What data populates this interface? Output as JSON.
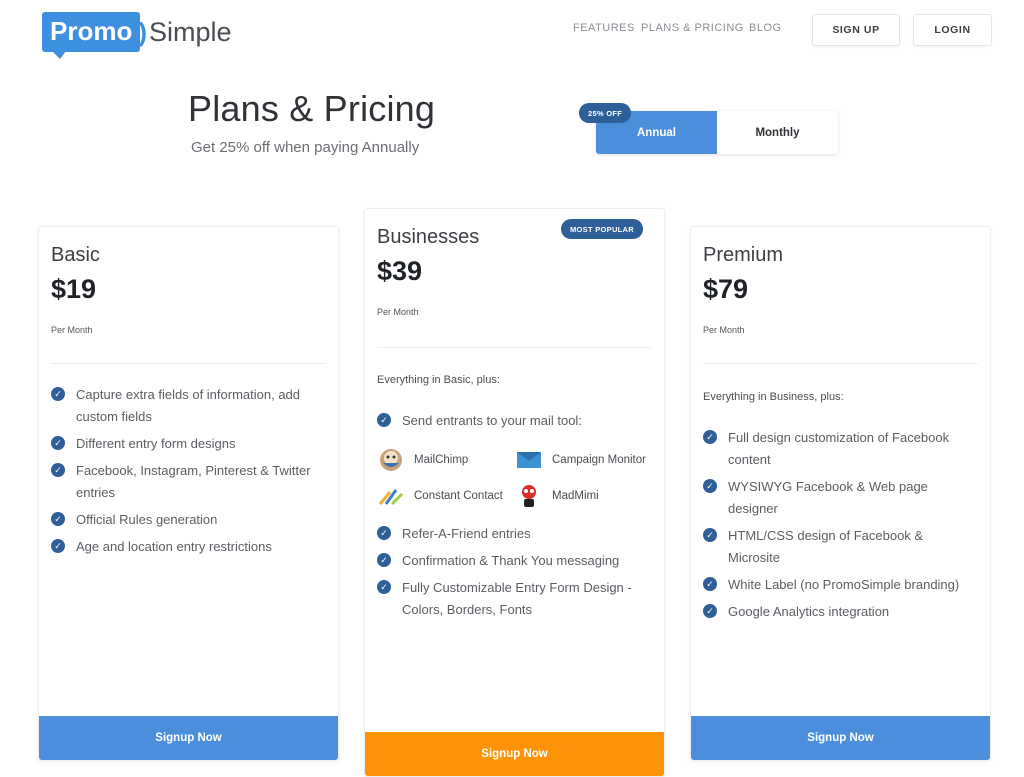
{
  "header": {
    "logo_promo": "Promo",
    "logo_simple": "Simple",
    "nav": [
      "FEATURES",
      "PLANS & PRICING",
      "BLOG"
    ],
    "signup_label": "SIGN UP",
    "login_label": "LOGIN"
  },
  "pricing": {
    "title": "Plans & Pricing",
    "subtitle": "Get 25% off when paying Annually",
    "toggle": {
      "annual": "Annual",
      "monthly": "Monthly",
      "selected": "Annual",
      "badge": "25% OFF"
    }
  },
  "plans": [
    {
      "name": "Basic",
      "price": "$19",
      "period": "Per Month",
      "features": [
        "Capture extra fields of information, add custom fields",
        "Different entry form designs",
        "Facebook, Instagram, Pinterest & Twitter entries",
        "Official Rules generation",
        "Age and location entry restrictions"
      ],
      "cta": "Signup Now"
    },
    {
      "name": "Businesses",
      "badge": "MOST POPULAR",
      "price": "$39",
      "period": "Per Month",
      "intro": "Everything in Basic, plus:",
      "mail_feature": "Send entrants to your mail tool:",
      "mail_tools": [
        "MailChimp",
        "Campaign Monitor",
        "Constant Contact",
        "MadMimi"
      ],
      "features": [
        "Refer-A-Friend entries",
        "Confirmation & Thank You messaging",
        "Fully Customizable Entry Form Design - Colors, Borders, Fonts"
      ],
      "cta": "Signup Now"
    },
    {
      "name": "Premium",
      "price": "$79",
      "period": "Per Month",
      "intro": "Everything in Business, plus:",
      "features": [
        "Full design customization of Facebook content",
        "WYSIWYG Facebook & Web page designer",
        "HTML/CSS design of Facebook & Microsite",
        "White Label (no PromoSimple branding)",
        "Google Analytics integration"
      ],
      "cta": "Signup Now"
    }
  ],
  "colors": {
    "accent_blue": "#4b8fdc",
    "dark_blue": "#2e5f99",
    "orange": "#ff9307"
  }
}
